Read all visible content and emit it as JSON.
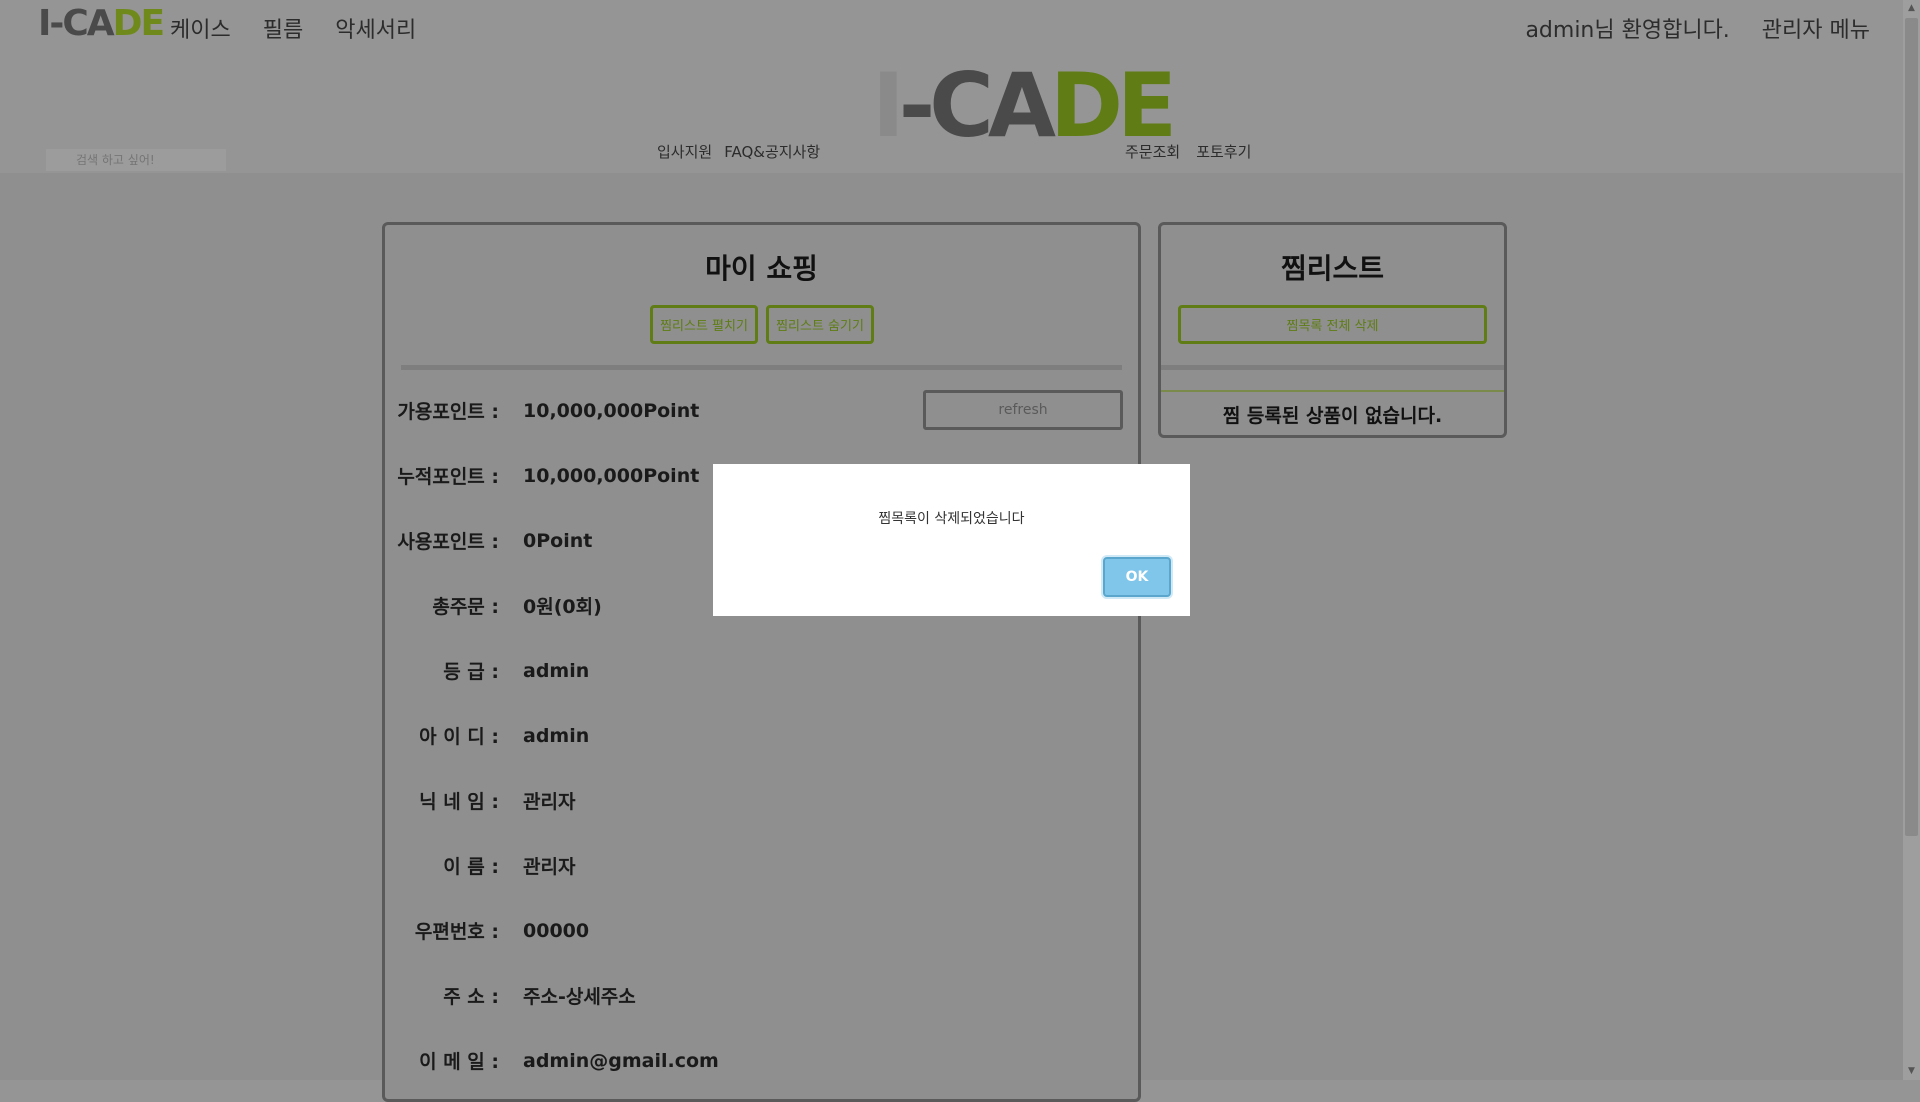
{
  "header": {
    "logo_left": "I-CA",
    "logo_right": "DE",
    "nav": [
      "케이스",
      "필름",
      "악세서리"
    ],
    "welcome": "admin님 환영합니다.",
    "admin_menu": "관리자 메뉴",
    "subnav_left": [
      "입사지원",
      "FAQ&공지사항"
    ],
    "subnav_right": [
      "주문조회",
      "포토후기"
    ],
    "search_placeholder": "검색 하고 싶어!"
  },
  "my_shopping": {
    "title": "마이 쇼핑",
    "btn_show_wishlist": "찜리스트 펼치기",
    "btn_hide_wishlist": "찜리스트 숨기기",
    "refresh_label": "refresh",
    "rows": [
      {
        "label": "가용포인트 :",
        "value": "10,000,000Point"
      },
      {
        "label": "누적포인트 :",
        "value": "10,000,000Point"
      },
      {
        "label": "사용포인트 :",
        "value": "0Point"
      },
      {
        "label": "총주문 :",
        "value": "0원(0회)"
      },
      {
        "label": "등 급 :",
        "value": "admin"
      },
      {
        "label": "아 이 디 :",
        "value": "admin"
      },
      {
        "label": "닉 네 임 :",
        "value": "관리자"
      },
      {
        "label": "이 름 :",
        "value": "관리자"
      },
      {
        "label": "우편번호 :",
        "value": "00000"
      },
      {
        "label": "주 소 :",
        "value": "주소-상세주소"
      },
      {
        "label": "이 메 일 :",
        "value": "admin@gmail.com"
      }
    ]
  },
  "wishlist": {
    "title": "찜리스트",
    "btn_clear": "찜목록 전체 삭제",
    "empty_message": "찜 등록된 상품이 없습니다."
  },
  "modal": {
    "message": "찜목록이 삭제되었습니다",
    "ok_label": "OK"
  }
}
